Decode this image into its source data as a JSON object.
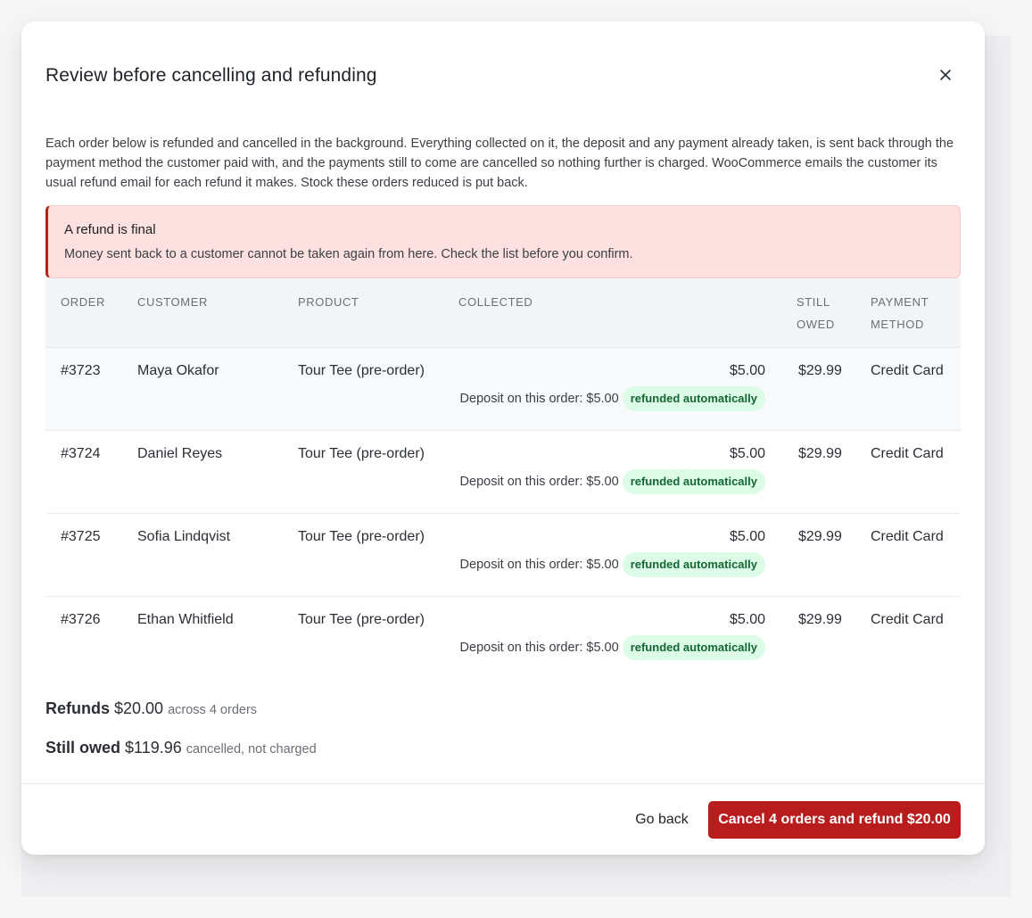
{
  "modal": {
    "title": "Review before cancelling and refunding",
    "intro": "Each order below is refunded and cancelled in the background. Everything collected on it, the deposit and any payment already taken, is sent back through the payment method the customer paid with, and the payments still to come are cancelled so nothing further is charged. WooCommerce emails the customer its usual refund email for each refund it makes. Stock these orders reduced is put back.",
    "alert": {
      "title": "A refund is final",
      "body": "Money sent back to a customer cannot be taken again from here. Check the list before you confirm."
    }
  },
  "table": {
    "headers": {
      "order": "ORDER",
      "customer": "CUSTOMER",
      "product": "PRODUCT",
      "collected": "COLLECTED",
      "still_owed_1": "STILL",
      "still_owed_2": "OWED",
      "payment_1": "PAYMENT",
      "payment_2": "METHOD"
    },
    "rows": [
      {
        "order": "#3723",
        "customer": "Maya Okafor",
        "product": "Tour Tee (pre-order)",
        "collected": "$5.00",
        "deposit": "Deposit on this order: $5.00",
        "badge": "refunded automatically",
        "still_owed": "$29.99",
        "payment": "Credit Card"
      },
      {
        "order": "#3724",
        "customer": "Daniel Reyes",
        "product": "Tour Tee (pre-order)",
        "collected": "$5.00",
        "deposit": "Deposit on this order: $5.00",
        "badge": "refunded automatically",
        "still_owed": "$29.99",
        "payment": "Credit Card"
      },
      {
        "order": "#3725",
        "customer": "Sofia Lindqvist",
        "product": "Tour Tee (pre-order)",
        "collected": "$5.00",
        "deposit": "Deposit on this order: $5.00",
        "badge": "refunded automatically",
        "still_owed": "$29.99",
        "payment": "Credit Card"
      },
      {
        "order": "#3726",
        "customer": "Ethan Whitfield",
        "product": "Tour Tee (pre-order)",
        "collected": "$5.00",
        "deposit": "Deposit on this order: $5.00",
        "badge": "refunded automatically",
        "still_owed": "$29.99",
        "payment": "Credit Card"
      }
    ]
  },
  "summary": {
    "refunds_label": "Refunds",
    "refunds_amount": "$20.00",
    "refunds_note": "across 4 orders",
    "owed_label": "Still owed",
    "owed_amount": "$119.96",
    "owed_note": "cancelled, not charged"
  },
  "footer": {
    "back_label": "Go back",
    "confirm_label": "Cancel 4 orders and refund $20.00"
  },
  "colors": {
    "danger": "#b91c1c",
    "alert_bg": "#fde1e1",
    "badge_bg": "#dcfce7",
    "badge_text": "#166534"
  },
  "icons": {
    "close": "close-icon"
  }
}
